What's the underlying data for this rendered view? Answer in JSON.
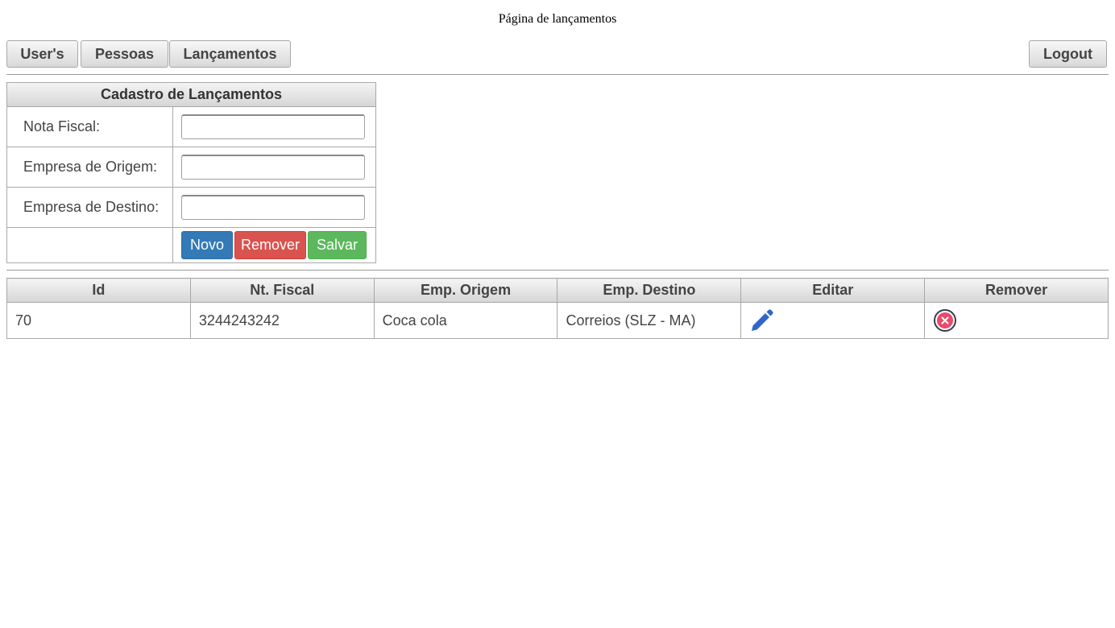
{
  "page": {
    "title": "Página de lançamentos"
  },
  "menu": {
    "users_label": "User's",
    "pessoas_label": "Pessoas",
    "lancamentos_label": "Lançamentos",
    "logout_label": "Logout"
  },
  "form": {
    "title": "Cadastro de Lançamentos",
    "fields": [
      {
        "label": "Nota Fiscal:",
        "value": "",
        "placeholder": ""
      },
      {
        "label": "Empresa de Origem:",
        "value": "",
        "placeholder": ""
      },
      {
        "label": "Empresa de Destino:",
        "value": "",
        "placeholder": ""
      }
    ],
    "buttons": {
      "novo": "Novo",
      "remover": "Remover",
      "salvar": "Salvar"
    }
  },
  "table": {
    "columns": [
      "Id",
      "Nt. Fiscal",
      "Emp. Origem",
      "Emp. Destino",
      "Editar",
      "Remover"
    ],
    "rows": [
      {
        "id": "70",
        "nota_fiscal": "3244243242",
        "origem": "Coca cola",
        "destino": "Correios (SLZ - MA)",
        "edit_icon": "pencil-icon",
        "remove_icon": "remove-circle-icon"
      }
    ]
  },
  "colors": {
    "novo": "#337ab7",
    "remover": "#d9534f",
    "salvar": "#5cb85c",
    "edit_icon": "#2f66c9",
    "remove_icon": "#e84b6c"
  }
}
